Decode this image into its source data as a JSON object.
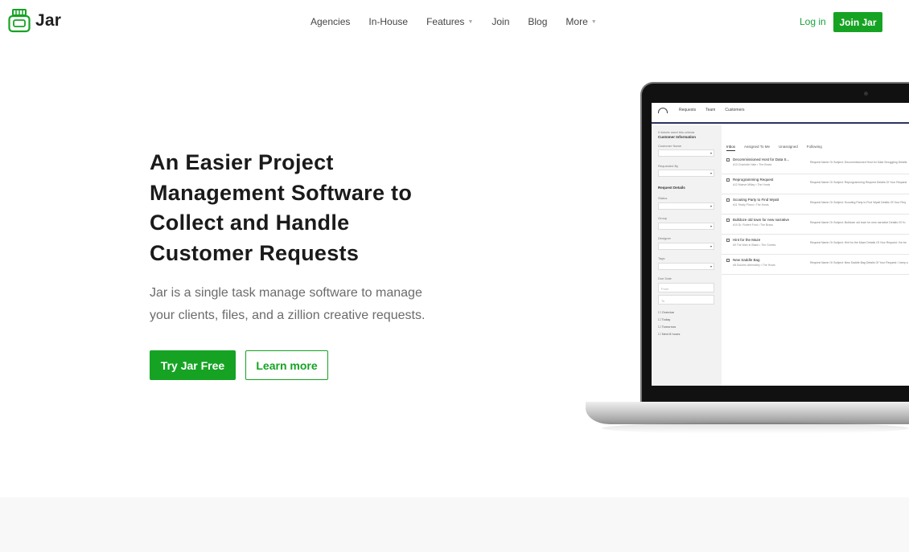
{
  "brand": {
    "name": "Jar",
    "accent": "#16a324"
  },
  "nav": {
    "links": [
      {
        "label": "Agencies",
        "dropdown": false
      },
      {
        "label": "In-House",
        "dropdown": false
      },
      {
        "label": "Features",
        "dropdown": true
      },
      {
        "label": "Join",
        "dropdown": false
      },
      {
        "label": "Blog",
        "dropdown": false
      },
      {
        "label": "More",
        "dropdown": true
      }
    ],
    "login": "Log in",
    "join": "Join Jar"
  },
  "hero": {
    "title_lines": [
      "An Easier Project",
      "Management Software to",
      "Collect and Handle",
      "Customer Requests"
    ],
    "subtitle_lines": [
      "Jar is a single task manage software to manage",
      "your clients, files, and a zillion creative requests."
    ],
    "cta_primary": "Try Jar Free",
    "cta_secondary": "Learn more"
  },
  "app": {
    "tabs": [
      "Requests",
      "Team",
      "Customers"
    ],
    "sidebar": {
      "matches": "0 tickets meet this criteria",
      "customer_info": "Customer Information",
      "customer_name": "Customer Name",
      "requested_by": "Requested By",
      "request_details": "Request Details",
      "status": "Status",
      "group": "Group",
      "designer": "Designer",
      "tags": "Tags",
      "due_date": "Due Date",
      "from": "From",
      "to": "To",
      "filters": [
        "Overdue",
        "Today",
        "Tomorrow",
        "Next 8 hours"
      ]
    },
    "inbox_tabs": [
      "Inbox",
      "Assigned To Me",
      "Unassigned",
      "Following"
    ],
    "requests": [
      {
        "title": "Decommissioned Host for Data S...",
        "meta": "#13 Charlotte Hale • The Brass",
        "desc": "Request Name Or Subject: Decommissioned Host for Data Smuggling Details"
      },
      {
        "title": "Reprogramming Request",
        "meta": "#12 Maeve Millay • The Hosts",
        "desc": "Request Name Or Subject: Reprogramming Request Details Of Your Request"
      },
      {
        "title": "Scouting Party to Find Wyatt",
        "meta": "#11 Teddy Flood • The Hosts",
        "desc": "Request Name Or Subject: Scouting Party to Find Wyatt Details Of Your Req"
      },
      {
        "title": "Bulldoze old town for new narrative",
        "meta": "#10 Dr. Robert Ford • The Brass",
        "desc": "Request Name Or Subject: Bulldoze old town for new narrative Details Of Yo"
      },
      {
        "title": "Hint for the Maze",
        "meta": "#9 The Man In Black • The Guests",
        "desc": "Request Name Or Subject: Hint for the Maze Details Of Your Request: I've be"
      },
      {
        "title": "New Saddle Bag",
        "meta": "#8 Dolores Abernathy • The Hosts",
        "desc": "Request Name Or Subject: New Saddle Bag Details Of Your Request: I keep a"
      }
    ]
  }
}
